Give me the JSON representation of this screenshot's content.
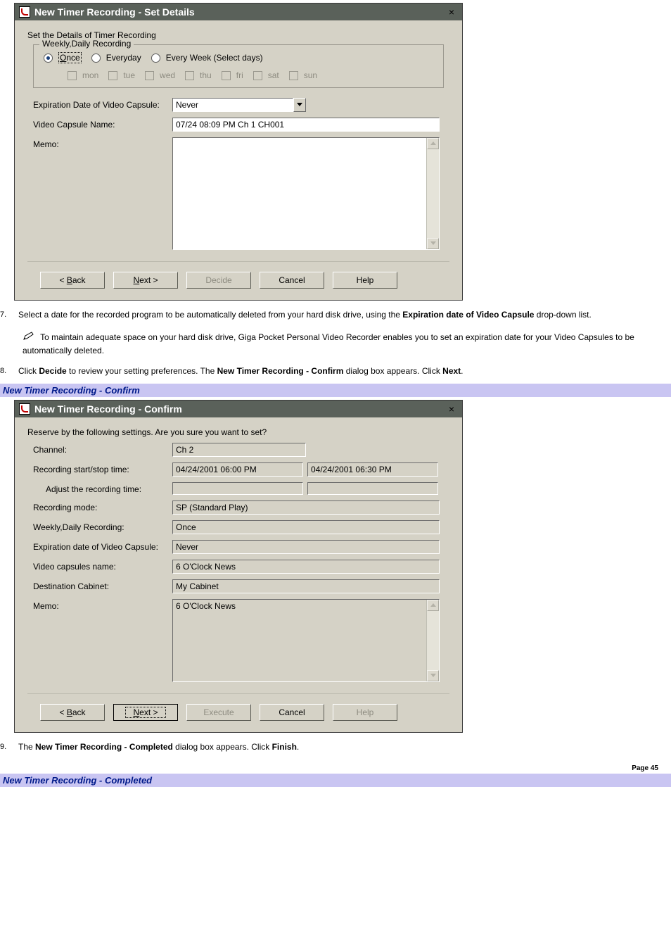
{
  "dlg1": {
    "title": "New Timer Recording - Set Details",
    "heading": "Set the Details of Timer Recording",
    "group_legend": "Weekly,Daily Recording",
    "radios": {
      "once": "Once",
      "everyday": "Everyday",
      "everyweek": "Every Week (Select days)"
    },
    "dow": {
      "mon": "mon",
      "tue": "tue",
      "wed": "wed",
      "thu": "thu",
      "fri": "fri",
      "sat": "sat",
      "sun": "sun"
    },
    "labels": {
      "expiration": "Expiration Date of Video Capsule:",
      "capsule_name": "Video Capsule Name:",
      "memo": "Memo:"
    },
    "values": {
      "expiration": "Never",
      "capsule_name": "07/24 08:09 PM Ch 1 CH001",
      "memo": ""
    },
    "buttons": {
      "back": "< Back",
      "next": "Next >",
      "decide": "Decide",
      "cancel": "Cancel",
      "help": "Help"
    }
  },
  "doc": {
    "step7_pre": "Select a date for the recorded program to be automatically deleted from your hard disk drive, using the ",
    "step7_bold": "Expiration date of Video Capsule",
    "step7_post": " drop-down list.",
    "note": " To maintain adequate space on your hard disk drive, Giga Pocket Personal Video Recorder enables you to set an expiration date for your Video Capsules to be automatically deleted.",
    "step8_a1": "Click ",
    "step8_b1": "Decide",
    "step8_a2": " to review your setting preferences. The ",
    "step8_b2": "New Timer Recording - Confirm",
    "step8_a3": " dialog box appears. Click ",
    "step8_b3": "Next",
    "step8_a4": ".",
    "caption1": "New Timer Recording - Confirm",
    "step9_a1": "The ",
    "step9_b1": "New Timer Recording - Completed",
    "step9_a2": " dialog box appears. Click ",
    "step9_b2": "Finish",
    "step9_a3": ".",
    "caption2": "New Timer Recording - Completed",
    "page": "Page 45",
    "num7": "7.",
    "num8": "8.",
    "num9": "9."
  },
  "dlg2": {
    "title": "New Timer Recording - Confirm",
    "heading": "Reserve by the following settings. Are you sure you want to set?",
    "labels": {
      "channel": "Channel:",
      "startstop": "Recording start/stop time:",
      "adjust": "Adjust the recording time:",
      "mode": "Recording mode:",
      "weekly": "Weekly,Daily Recording:",
      "expiration": "Expiration date of Video Capsule:",
      "capsules": "Video capsules name:",
      "cabinet": "Destination Cabinet:",
      "memo": "Memo:"
    },
    "values": {
      "channel": "Ch 2",
      "start": "04/24/2001 06:00 PM",
      "stop": "04/24/2001 06:30 PM",
      "adjust": "",
      "mode": "SP (Standard Play)",
      "weekly": "Once",
      "expiration": "Never",
      "capsules": "6 O'Clock News",
      "cabinet": "My Cabinet",
      "memo": "6 O'Clock News"
    },
    "buttons": {
      "back": "< Back",
      "next": "Next >",
      "execute": "Execute",
      "cancel": "Cancel",
      "help": "Help"
    }
  }
}
